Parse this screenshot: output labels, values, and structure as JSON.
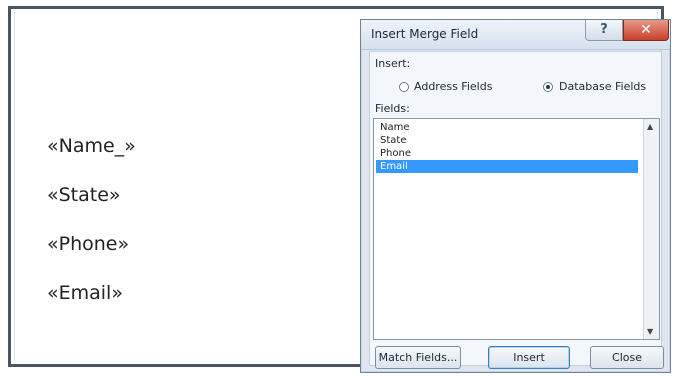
{
  "document": {
    "fields": [
      "«Name_»",
      "«State»",
      "«Phone»",
      "«Email»"
    ]
  },
  "dialog": {
    "title": "Insert Merge Field",
    "help_glyph": "?",
    "close_glyph": "✕",
    "insert_label": "Insert:",
    "address_fields_label": "Address Fields",
    "database_fields_label": "Database Fields",
    "selected_option": "Database Fields",
    "fields_label": "Fields:",
    "fields": [
      "Name",
      "State",
      "Phone",
      "Email"
    ],
    "selected_field": "Email",
    "buttons": {
      "match_fields": "Match Fields...",
      "insert": "Insert",
      "close": "Close"
    }
  },
  "colors": {
    "selection": "#3399ff",
    "close_button": "#c7402c",
    "dialog_background": "#dfe6ef"
  }
}
